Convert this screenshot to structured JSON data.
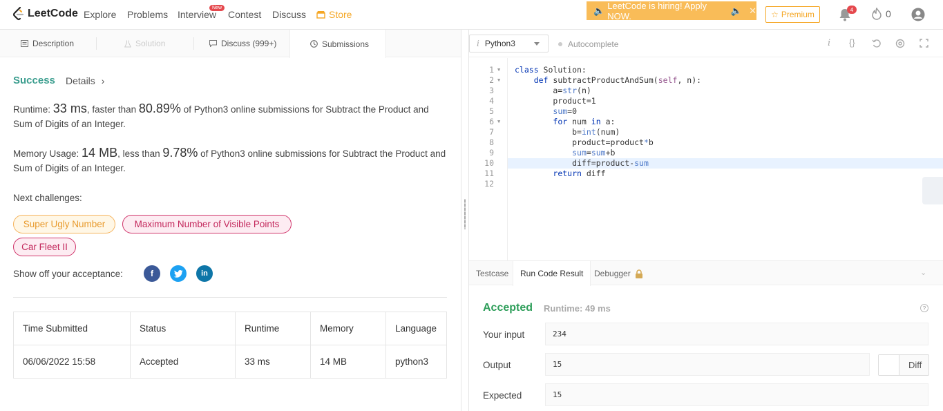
{
  "nav": {
    "logo_text": "LeetCode",
    "links": [
      "Explore",
      "Problems",
      "Interview",
      "Contest",
      "Discuss",
      "Store"
    ],
    "new_badge": "New",
    "hiring_banner": "LeetCode is hiring! Apply NOW.",
    "premium_label": "Premium",
    "notification_count": "4",
    "coins": "0"
  },
  "left_tabs": [
    "Description",
    "Solution",
    "Discuss (999+)",
    "Submissions"
  ],
  "result": {
    "status": "Success",
    "details_label": "Details",
    "runtime_label": "Runtime:",
    "runtime_value": "33 ms",
    "runtime_mid": ", faster than ",
    "runtime_pct": "80.89%",
    "runtime_tail": " of Python3 online submissions for Subtract the Product and Sum of Digits of an Integer.",
    "memory_label": "Memory Usage:",
    "memory_value": "14 MB",
    "memory_mid": ", less than ",
    "memory_pct": "9.78%",
    "memory_tail": " of Python3 online submissions for Subtract the Product and Sum of Digits of an Integer.",
    "next_label": "Next challenges:",
    "challenges": [
      "Super Ugly Number",
      "Maximum Number of Visible Points",
      "Car Fleet II"
    ],
    "share_label": "Show off your acceptance:"
  },
  "submissions_table": {
    "headers": [
      "Time Submitted",
      "Status",
      "Runtime",
      "Memory",
      "Language"
    ],
    "rows": [
      [
        "06/06/2022 15:58",
        "Accepted",
        "33 ms",
        "14 MB",
        "python3"
      ]
    ]
  },
  "editor": {
    "language": "Python3",
    "autocomplete_label": "Autocomplete",
    "line_numbers": [
      "1",
      "2",
      "3",
      "4",
      "5",
      "6",
      "7",
      "8",
      "9",
      "10",
      "11",
      "12"
    ]
  },
  "bottom_tabs": [
    "Testcase",
    "Run Code Result",
    "Debugger"
  ],
  "run_result": {
    "status": "Accepted",
    "runtime": "Runtime: 49 ms",
    "input_label": "Your input",
    "input_value": "234",
    "output_label": "Output",
    "output_value": "15",
    "expected_label": "Expected",
    "expected_value": "15",
    "diff_label": "Diff"
  },
  "colors": {
    "accent_green": "#3c9e8f",
    "store_orange": "#f5a623",
    "banner": "#f9bc58"
  }
}
